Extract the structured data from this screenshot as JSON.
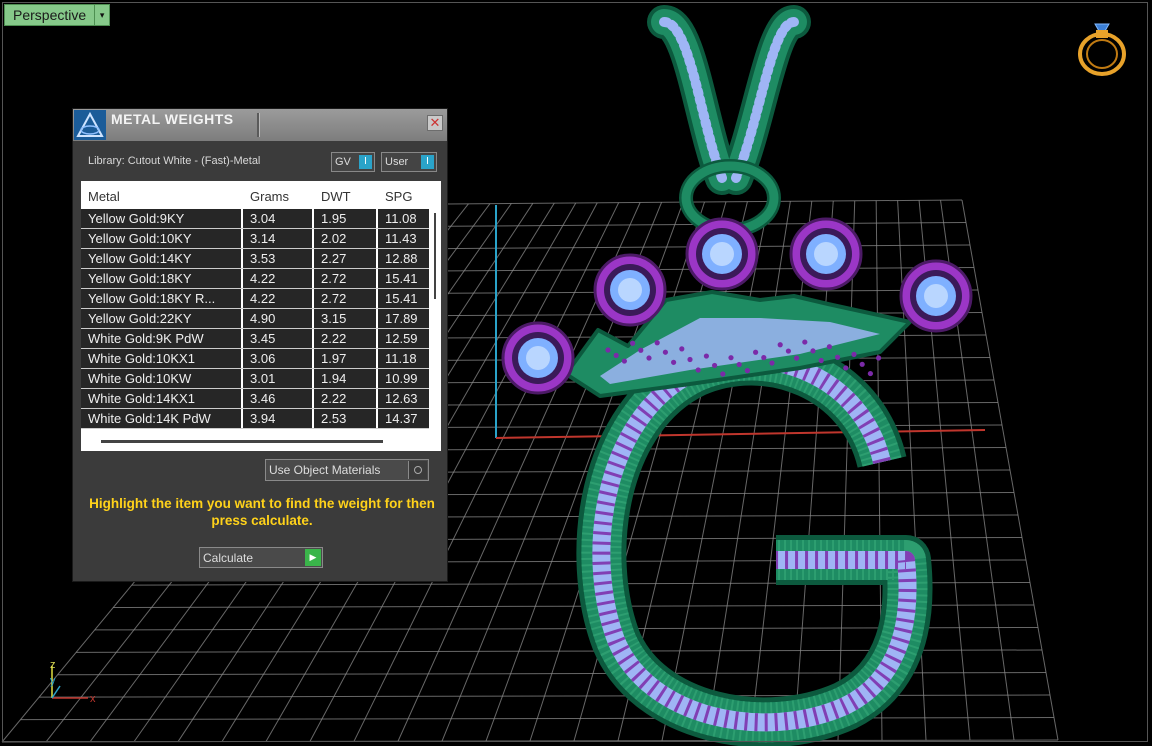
{
  "viewport": {
    "view_name": "Perspective",
    "dropdown_glyph": "▾",
    "icons": [
      "ring-icon",
      "axis-gizmo-icon"
    ],
    "axis_labels": {
      "z": "z",
      "y": "y",
      "x": "x"
    }
  },
  "panel": {
    "title": "METAL WEIGHTS",
    "close_glyph": "✕",
    "library_label": "Library: Cutout White - (Fast)-Metal",
    "toggles": [
      {
        "label": "GV",
        "knob": "I"
      },
      {
        "label": "User",
        "knob": "I"
      }
    ],
    "table": {
      "columns": [
        "Metal",
        "Grams",
        "DWT",
        "SPG"
      ],
      "rows": [
        [
          "Yellow Gold:9KY",
          "3.04",
          "1.95",
          "11.08"
        ],
        [
          "Yellow Gold:10KY",
          "3.14",
          "2.02",
          "11.43"
        ],
        [
          "Yellow Gold:14KY",
          "3.53",
          "2.27",
          "12.88"
        ],
        [
          "Yellow Gold:18KY",
          "4.22",
          "2.72",
          "15.41"
        ],
        [
          "Yellow Gold:18KY R...",
          "4.22",
          "2.72",
          "15.41"
        ],
        [
          "Yellow Gold:22KY",
          "4.90",
          "3.15",
          "17.89"
        ],
        [
          "White Gold:9K PdW",
          "3.45",
          "2.22",
          "12.59"
        ],
        [
          "White Gold:10KX1",
          "3.06",
          "1.97",
          "11.18"
        ],
        [
          "White Gold:10KW",
          "3.01",
          "1.94",
          "10.99"
        ],
        [
          "White Gold:14KX1",
          "3.46",
          "2.22",
          "12.63"
        ],
        [
          "White Gold:14K PdW",
          "3.94",
          "2.53",
          "14.37"
        ]
      ]
    },
    "use_object_materials": "Use Object Materials",
    "hint": "Highlight the item you want to find the weight for then press calculate.",
    "calculate_label": "Calculate",
    "calculate_glyph": "▶"
  },
  "colors": {
    "metal": "#1e8c63",
    "metal_dark": "#0c5a3e",
    "bead": "#2fa071",
    "pave": "#9fb5f5",
    "amethyst": "#7b2aa8",
    "bezel": "#9b36c6",
    "gem": "#7fb0ff",
    "grid": "#8a8a8a",
    "axis_x": "#c0362d",
    "axis_y": "#2aa3c9",
    "hint": "#ffd21a",
    "view_label_bg": "#86c98a"
  }
}
